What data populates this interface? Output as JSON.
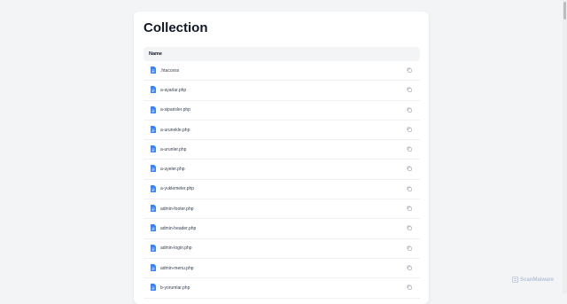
{
  "page": {
    "title": "Collection"
  },
  "table": {
    "header": "Name",
    "rows": [
      {
        "name": ".htaccess"
      },
      {
        "name": "a-ayarlar.php"
      },
      {
        "name": "a-siparisler.php"
      },
      {
        "name": "a-urunekle.php"
      },
      {
        "name": "a-urunler.php"
      },
      {
        "name": "a-uyeler.php"
      },
      {
        "name": "a-yuklemeler.php"
      },
      {
        "name": "admin-footer.php"
      },
      {
        "name": "admin-header.php"
      },
      {
        "name": "admin-login.php"
      },
      {
        "name": "admin-menu.php"
      },
      {
        "name": "b-yorumlar.php"
      }
    ]
  },
  "brand": {
    "name": "ScanMalware"
  },
  "colors": {
    "file_icon": "#3b82f6",
    "copy_icon": "#9ca3af",
    "brand": "#b9c3d6"
  },
  "icons": {
    "file": "file-text-icon",
    "copy": "copy-icon",
    "brand": "scanmalware-logo"
  }
}
